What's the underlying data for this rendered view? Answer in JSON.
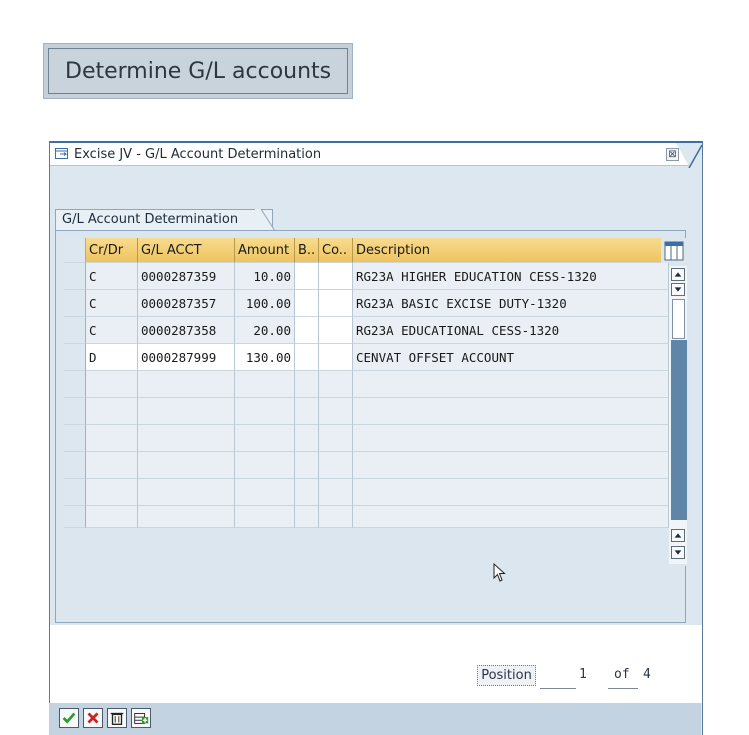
{
  "top_button": {
    "label": "Determine G/L accounts"
  },
  "dialog": {
    "title": "Excise JV - G/L Account Determination",
    "group_title": "G/L Account Determination",
    "table": {
      "columns": [
        "Cr/Dr",
        "G/L ACCT",
        "Amount",
        "B..",
        "Co..",
        "Description"
      ],
      "rows": [
        {
          "crdr": "C",
          "gl_acct": "0000287359",
          "amount": "10.00",
          "b": "",
          "co": "",
          "description": "RG23A HIGHER EDUCATION CESS-1320"
        },
        {
          "crdr": "C",
          "gl_acct": "0000287357",
          "amount": "100.00",
          "b": "",
          "co": "",
          "description": "RG23A BASIC EXCISE DUTY-1320"
        },
        {
          "crdr": "C",
          "gl_acct": "0000287358",
          "amount": "20.00",
          "b": "",
          "co": "",
          "description": "RG23A EDUCATIONAL CESS-1320"
        },
        {
          "crdr": "D",
          "gl_acct": "0000287999",
          "amount": "130.00",
          "b": "",
          "co": "",
          "description": "CENVAT OFFSET ACCOUNT"
        }
      ],
      "empty_rows": 6
    },
    "position": {
      "label": "Position",
      "current": "1",
      "of_label": "of",
      "total": "4"
    },
    "close_glyph": "⊠"
  },
  "colors": {
    "header_gold": "#efc35f",
    "dialog_bg": "#dde7ef",
    "title_blue": "#3b6ea5"
  },
  "icons": {
    "title": "dialog-window-icon",
    "close": "close-icon",
    "table_settings": "table-settings-icon",
    "toolbar": [
      "check-icon",
      "cancel-icon",
      "delete-icon",
      "add-row-icon"
    ]
  }
}
